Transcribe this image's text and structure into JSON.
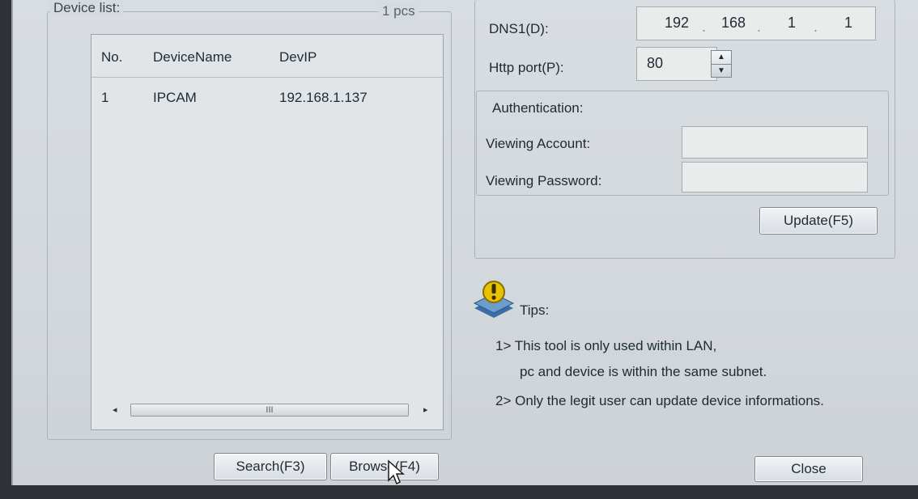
{
  "device_list": {
    "label": "Device list:",
    "count": "1 pcs",
    "columns": [
      "No.",
      "DeviceName",
      "DevIP"
    ],
    "rows": [
      {
        "no": "1",
        "name": "IPCAM",
        "ip": "192.168.1.137"
      }
    ],
    "scroll_thumb_glyph": "III"
  },
  "buttons": {
    "search": "Search(F3)",
    "browse": "Browse(F4)",
    "update": "Update(F5)",
    "close": "Close"
  },
  "network": {
    "dns1_label": "DNS1(D):",
    "dns1_octets": [
      "192",
      "168",
      "1",
      "1"
    ],
    "http_port_label": "Http port(P):",
    "http_port_value": "80"
  },
  "auth": {
    "title": "Authentication:",
    "account_label": "Viewing Account:",
    "account_value": "",
    "password_label": "Viewing Password:",
    "password_value": ""
  },
  "tips": {
    "title": "Tips:",
    "line1": "1> This tool is only used within LAN,",
    "line1b": "pc and device is within the same subnet.",
    "line2": "2> Only the legit user can update  device informations."
  },
  "icons": {
    "tips": "warning-stack-icon",
    "spin_up": "spin-up-icon",
    "spin_down": "spin-down-icon"
  },
  "colors": {
    "window_bg": "#d6dbdf",
    "tips_icon_yellow": "#e6c200",
    "tips_icon_blue": "#3b6ea8"
  }
}
